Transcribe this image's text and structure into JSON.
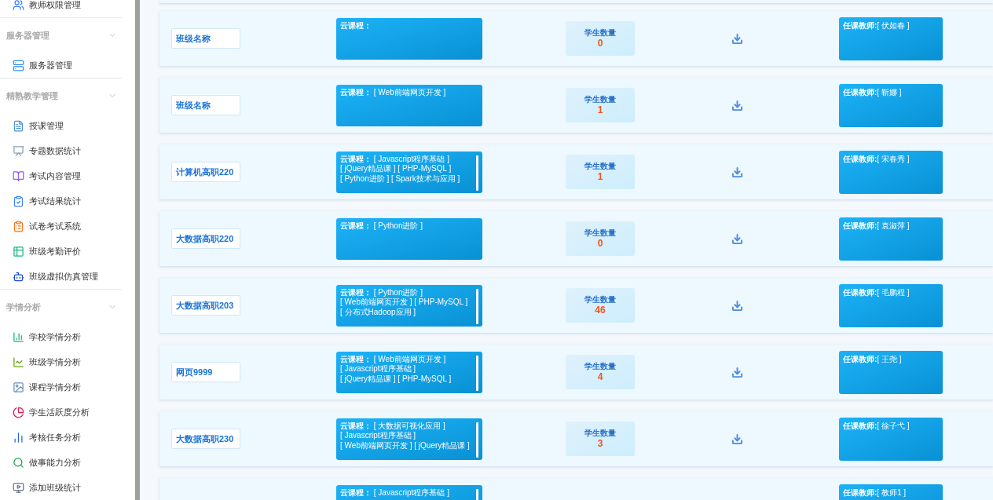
{
  "sidebar": {
    "top_items": [
      {
        "label": "教师权限管理"
      }
    ],
    "sections": [
      {
        "title": "服务器管理",
        "expanded": true,
        "items": [
          {
            "label": "服务器管理"
          }
        ]
      },
      {
        "title": "精熟教学管理",
        "expanded": true,
        "items": [
          {
            "label": "授课管理"
          },
          {
            "label": "专题数据统计"
          },
          {
            "label": "考试内容管理"
          },
          {
            "label": "考试结果统计"
          },
          {
            "label": "试卷考试系统"
          },
          {
            "label": "班级考勤评价"
          },
          {
            "label": "班级虚拟仿真管理"
          }
        ]
      },
      {
        "title": "学情分析",
        "expanded": true,
        "items": [
          {
            "label": "学校学情分析"
          },
          {
            "label": "班级学情分析"
          },
          {
            "label": "课程学情分析"
          },
          {
            "label": "学生活跃度分析"
          },
          {
            "label": "考核任务分析"
          },
          {
            "label": "做事能力分析"
          },
          {
            "label": "添加班级统计"
          }
        ]
      }
    ]
  },
  "classes": [
    {
      "class_name": "班级名称",
      "course_label": "云课程：",
      "scrollable": false,
      "count_label": "学生数量",
      "count": "0",
      "teacher_label": "任课教师:",
      "teacher": "[ 伏如春 ]"
    },
    {
      "class_name": "班级名称",
      "course_label": "云课程：",
      "courses": [
        "[ Web前端网页开发 ]"
      ],
      "scrollable": false,
      "count_label": "学生数量",
      "count": "1",
      "teacher_label": "任课教师:",
      "teacher": "[ 靳娜 ]"
    },
    {
      "class_name": "计算机高职220",
      "course_label": "云课程：",
      "courses": [
        "[ Javascript程序基础 ]",
        "[ jQuery精品课 ] [ PHP-MySQL ]",
        "[ Python进阶 ] [ Spark技术与应用 ]"
      ],
      "scrollable": true,
      "count_label": "学生数量",
      "count": "1",
      "teacher_label": "任课教师:",
      "teacher": "[ 宋春秀 ]"
    },
    {
      "class_name": "大数据高职220",
      "course_label": "云课程：",
      "courses": [
        "[ Python进阶 ]"
      ],
      "scrollable": false,
      "count_label": "学生数量",
      "count": "0",
      "teacher_label": "任课教师:",
      "teacher": "[ 袁淑萍 ]"
    },
    {
      "class_name": "大数据高职203",
      "course_label": "云课程：",
      "courses": [
        "[ Python进阶 ]",
        "[ Web前端网页开发 ] [ PHP-MySQL ]",
        "[ 分布式Hadoop应用 ]"
      ],
      "scrollable": true,
      "count_label": "学生数量",
      "count": "46",
      "teacher_label": "任课教师:",
      "teacher": "[ 毛鹏程 ]"
    },
    {
      "class_name": "网页9999",
      "course_label": "云课程：",
      "courses": [
        "[ Web前端网页开发 ]",
        "[ Javascript程序基础 ]",
        "[ jQuery精品课 ] [ PHP-MySQL ]"
      ],
      "scrollable": true,
      "count_label": "学生数量",
      "count": "4",
      "teacher_label": "任课教师:",
      "teacher": "[ 王尧 ]"
    },
    {
      "class_name": "大数据高职230",
      "course_label": "云课程：",
      "courses": [
        "[ 大数据可视化应用 ]",
        "[ Javascript程序基础 ]",
        "[ Web前端网页开发 ] [ jQuery精品课 ]"
      ],
      "scrollable": true,
      "count_label": "学生数量",
      "count": "3",
      "teacher_label": "任课教师:",
      "teacher": "[ 徐子弋 ]"
    },
    {
      "course_label": "云课程：",
      "courses": [
        "[ Javascript程序基础 ]"
      ],
      "scrollable": true,
      "teacher_label": "任课教师:",
      "teacher": "[ 教师1 ]"
    }
  ]
}
